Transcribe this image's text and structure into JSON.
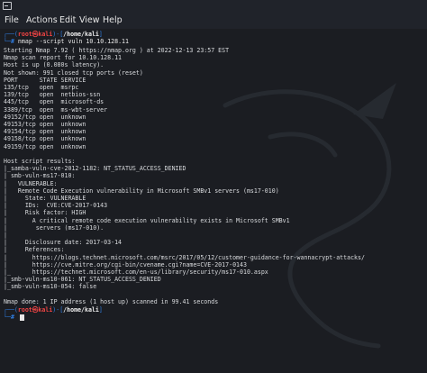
{
  "menu": {
    "items": [
      "File",
      "Actions",
      "Edit",
      "View",
      "Help"
    ]
  },
  "prompt": {
    "user_host": "root㉿kali",
    "path": "/home/kali",
    "symbol": "#"
  },
  "command": "nmap --script vuln 10.10.128.11",
  "output_lines": [
    "Starting Nmap 7.92 ( https://nmap.org ) at 2022-12-13 23:57 EST",
    "Nmap scan report for 10.10.128.11",
    "Host is up (0.080s latency).",
    "Not shown: 991 closed tcp ports (reset)",
    "PORT      STATE SERVICE",
    "135/tcp   open  msrpc",
    "139/tcp   open  netbios-ssn",
    "445/tcp   open  microsoft-ds",
    "3389/tcp  open  ms-wbt-server",
    "49152/tcp open  unknown",
    "49153/tcp open  unknown",
    "49154/tcp open  unknown",
    "49158/tcp open  unknown",
    "49159/tcp open  unknown",
    "",
    "Host script results:",
    "|_samba-vuln-cve-2012-1182: NT_STATUS_ACCESS_DENIED",
    "| smb-vuln-ms17-010:",
    "|   VULNERABLE:",
    "|   Remote Code Execution vulnerability in Microsoft SMBv1 servers (ms17-010)",
    "|     State: VULNERABLE",
    "|     IDs:  CVE:CVE-2017-0143",
    "|     Risk factor: HIGH",
    "|       A critical remote code execution vulnerability exists in Microsoft SMBv1",
    "|        servers (ms17-010).",
    "|",
    "|     Disclosure date: 2017-03-14",
    "|     References:",
    "|       https://blogs.technet.microsoft.com/msrc/2017/05/12/customer-guidance-for-wannacrypt-attacks/",
    "|       https://cve.mitre.org/cgi-bin/cvename.cgi?name=CVE-2017-0143",
    "|_      https://technet.microsoft.com/en-us/library/security/ms17-010.aspx",
    "|_smb-vuln-ms10-061: NT_STATUS_ACCESS_DENIED",
    "|_smb-vuln-ms10-054: false",
    "",
    "Nmap done: 1 IP address (1 host up) scanned in 99.41 seconds",
    ""
  ],
  "colors": {
    "prompt_frame": "#2f7de1",
    "prompt_user": "#f14444",
    "background": "#1b1d22",
    "text": "#d8dadd"
  }
}
